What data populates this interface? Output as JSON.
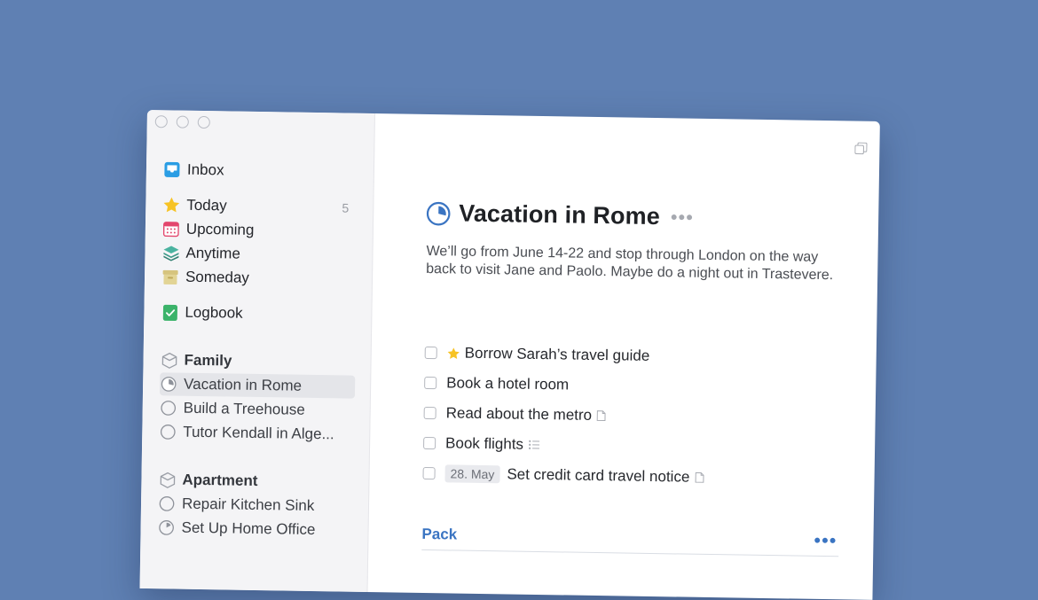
{
  "sidebar": {
    "inbox": {
      "label": "Inbox",
      "icon": "inbox-icon"
    },
    "today": {
      "label": "Today",
      "count": "5",
      "icon": "star-icon"
    },
    "upcoming": {
      "label": "Upcoming",
      "icon": "calendar-icon"
    },
    "anytime": {
      "label": "Anytime",
      "icon": "layers-icon"
    },
    "someday": {
      "label": "Someday",
      "icon": "archive-box-icon"
    },
    "logbook": {
      "label": "Logbook",
      "icon": "logbook-icon"
    },
    "areas": [
      {
        "title": "Family",
        "projects": [
          {
            "label": "Vacation in Rome",
            "selected": true
          },
          {
            "label": "Build a Treehouse"
          },
          {
            "label": "Tutor Kendall in Alge..."
          }
        ]
      },
      {
        "title": "Apartment",
        "projects": [
          {
            "label": "Repair Kitchen Sink"
          },
          {
            "label": "Set Up Home Office"
          }
        ]
      }
    ]
  },
  "project": {
    "title": "Vacation in Rome",
    "more": "•••",
    "notes": "We’ll go from June 14-22 and stop through London on the way back to visit Jane and Paolo. Maybe do a night out in Trastevere.",
    "todos": [
      {
        "label": "Borrow Sarah’s travel guide",
        "starred": true
      },
      {
        "label": "Book a hotel room"
      },
      {
        "label": "Read about the metro",
        "after_icon": "note-icon"
      },
      {
        "label": "Book flights",
        "after_icon": "checklist-icon"
      },
      {
        "label": "Set credit card travel notice",
        "date": "28. May",
        "after_icon": "note-icon"
      }
    ],
    "heading": {
      "label": "Pack",
      "more": "•••"
    }
  },
  "colors": {
    "background": "#5f80b3",
    "accent": "#3a74c2",
    "star": "#f7c325"
  }
}
